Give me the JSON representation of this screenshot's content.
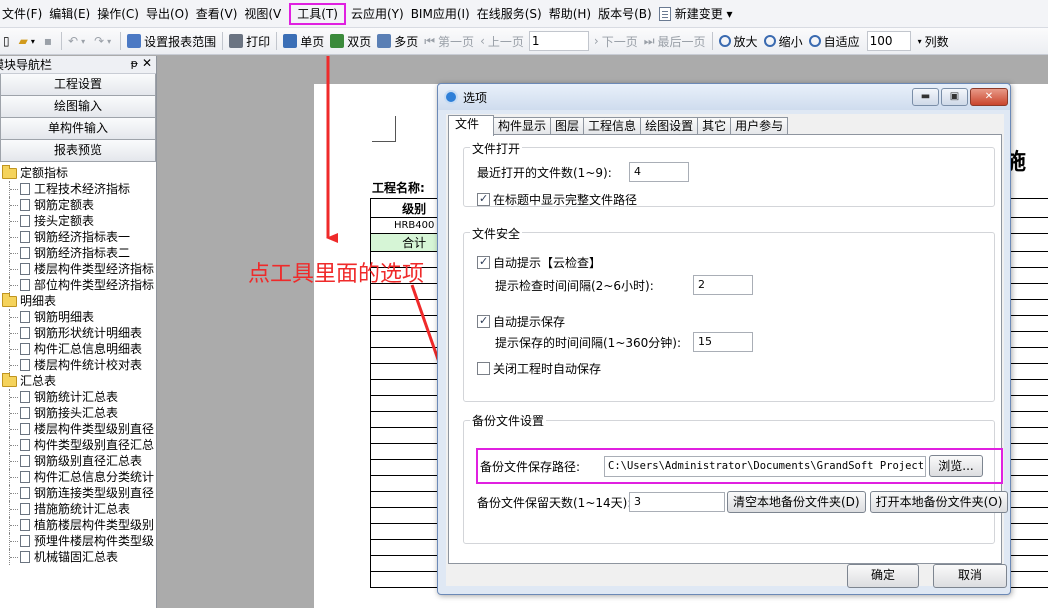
{
  "menu": [
    "文件(F)",
    "编辑(E)",
    "操作(C)",
    "导出(O)",
    "查看(V)",
    "视图(V",
    "工具(T)",
    "云应用(Y)",
    "BIM应用(I)",
    "在线服务(S)",
    "帮助(H)",
    "版本号(B)",
    "新建变更 ▾"
  ],
  "toolbar": {
    "set_range": "设置报表范围",
    "print": "打印",
    "single": "单页",
    "double": "双页",
    "multi": "多页",
    "first": "第一页",
    "prev": "上一页",
    "page_value": "1",
    "next": "下一页",
    "last": "最后一页",
    "zoom_in": "放大",
    "zoom_out": "缩小",
    "fit": "自适应",
    "zoom_value": "100",
    "columns": "列数"
  },
  "nav": {
    "title": "模块导航栏",
    "pin": "ᵽ",
    "close": "✕",
    "buttons": [
      "工程设置",
      "绘图输入",
      "单构件输入",
      "报表预览"
    ],
    "groups": [
      {
        "label": "定额指标",
        "items": [
          "工程技术经济指标",
          "钢筋定额表",
          "接头定额表",
          "钢筋经济指标表一",
          "钢筋经济指标表二",
          "楼层构件类型经济指标",
          "部位构件类型经济指标"
        ]
      },
      {
        "label": "明细表",
        "items": [
          "钢筋明细表",
          "钢筋形状统计明细表",
          "构件汇总信息明细表",
          "楼层构件统计校对表"
        ]
      },
      {
        "label": "汇总表",
        "items": [
          "钢筋统计汇总表",
          "钢筋接头汇总表",
          "楼层构件类型级别直径",
          "构件类型级别直径汇总",
          "钢筋级别直径汇总表",
          "构件汇总信息分类统计",
          "钢筋连接类型级别直径",
          "措施筋统计汇总表",
          "植筋楼层构件类型级别",
          "预埋件楼层构件类型级",
          "机械锚固汇总表"
        ]
      }
    ]
  },
  "report": {
    "project_label": "工程名称:",
    "title_fragment": "措施",
    "table": {
      "header": "级别",
      "row1": "HRB400",
      "total": "合计"
    }
  },
  "annotation": {
    "text": "点工具里面的选项",
    "color": "#ef2a2a"
  },
  "dialog": {
    "title": "选项",
    "min": "▬",
    "max": "▣",
    "close": "✕",
    "tabs": [
      "文件",
      "构件显示",
      "图层",
      "工程信息",
      "绘图设置",
      "其它",
      "用户参与"
    ],
    "file_open": {
      "title": "文件打开",
      "recent_label": "最近打开的文件数(1~9):",
      "recent_value": "4",
      "show_path_label": "在标题中显示完整文件路径",
      "show_path_checked": true
    },
    "file_safety": {
      "title": "文件安全",
      "auto_check_label": "自动提示【云检查】",
      "auto_check_checked": true,
      "check_interval_label": "提示检查时间间隔(2~6小时):",
      "check_interval_value": "2",
      "auto_save_label": "自动提示保存",
      "auto_save_checked": true,
      "save_interval_label": "提示保存的时间间隔(1~360分钟):",
      "save_interval_value": "15",
      "close_autosave_label": "关闭工程时自动保存",
      "close_autosave_checked": false
    },
    "backup": {
      "title": "备份文件设置",
      "path_label": "备份文件保存路径:",
      "path_value": "C:\\Users\\Administrator\\Documents\\GrandSoft Projects\\GGJ",
      "browse": "浏览...",
      "days_label": "备份文件保留天数(1~14天):",
      "days_value": "3",
      "clear_btn": "清空本地备份文件夹(D)",
      "open_btn": "打开本地备份文件夹(O)"
    },
    "ok": "确定",
    "cancel": "取消"
  },
  "colors": {
    "highlight": "#e020e0",
    "arrow": "#ef2a2a"
  }
}
